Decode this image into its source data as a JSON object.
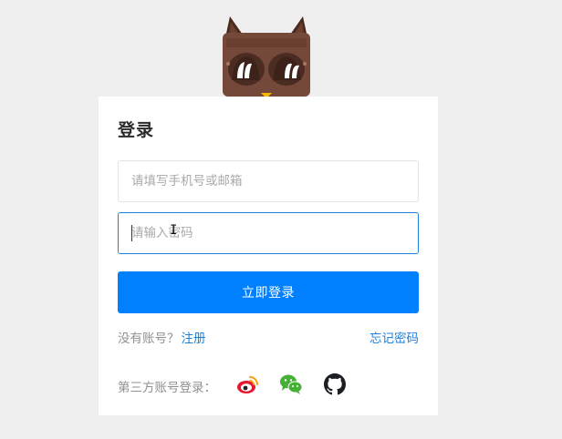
{
  "login": {
    "title": "登录",
    "phone_placeholder": "请填写手机号或邮箱",
    "password_placeholder": "请输入密码",
    "submit_label": "立即登录",
    "no_account_text": "没有账号？",
    "register_label": "注册",
    "forgot_label": "忘记密码",
    "third_party_label": "第三方账号登录："
  },
  "icons": {
    "mascot": "owl-mascot",
    "social": [
      "weibo-icon",
      "wechat-icon",
      "github-icon"
    ]
  },
  "colors": {
    "background": "#efefef",
    "card": "#ffffff",
    "primary": "#0080ff",
    "link": "#1e80d8",
    "focus_border": "#1e80d8",
    "muted_text": "#909090"
  }
}
